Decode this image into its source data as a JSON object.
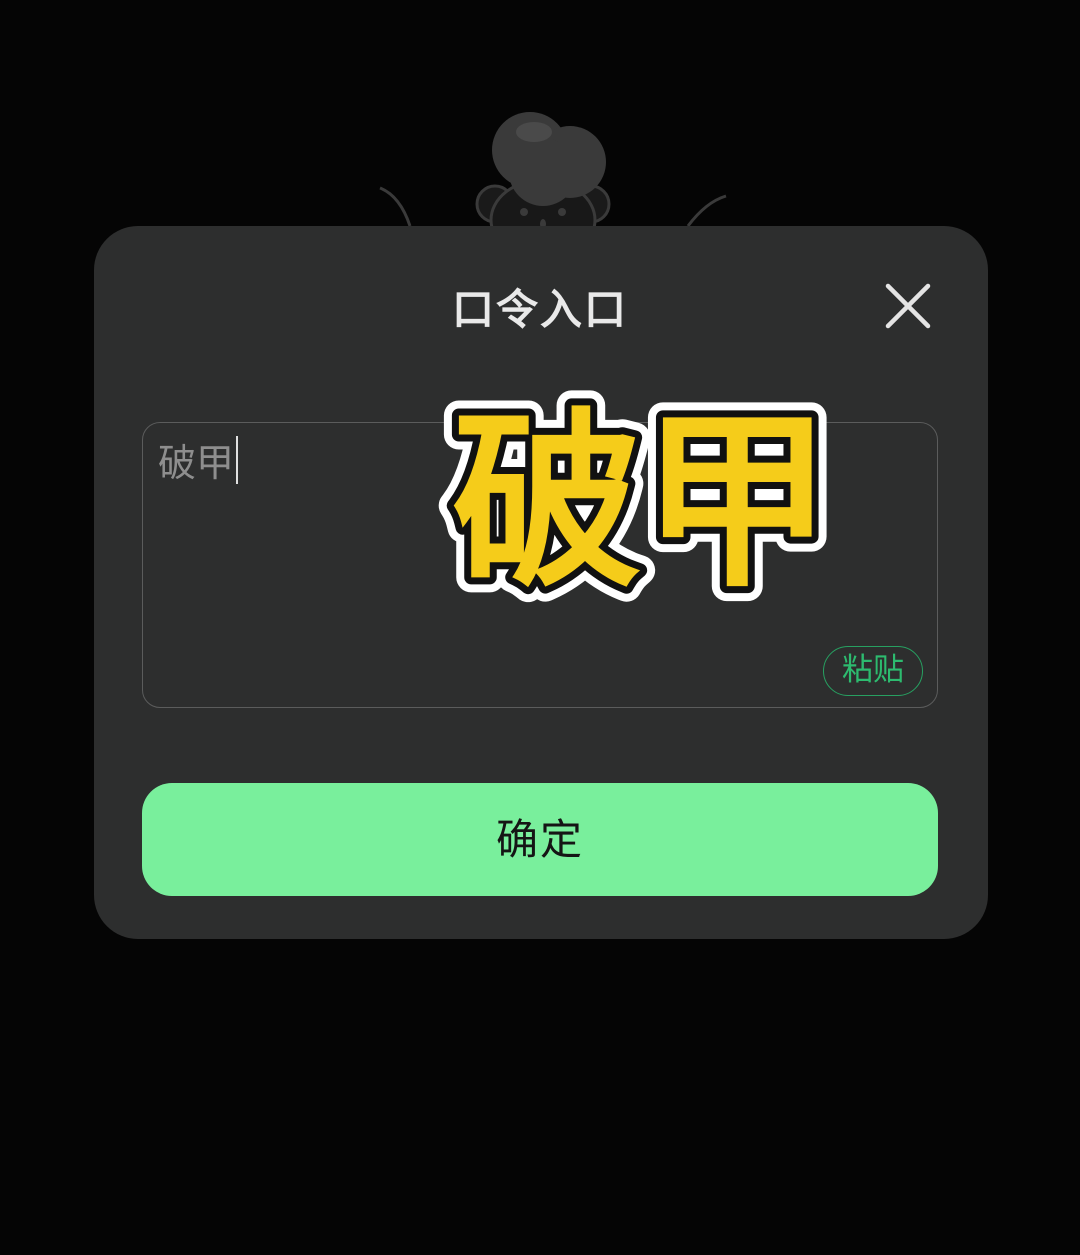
{
  "dialog": {
    "title": "口令入口",
    "input_value": "破甲",
    "paste_label": "粘贴",
    "confirm_label": "确定"
  },
  "overlay": {
    "sticker_text": "破甲"
  },
  "icons": {
    "close": "close-icon",
    "mascot": "mascot-illustration"
  },
  "colors": {
    "page_bg": "#050505",
    "dialog_bg": "#2d2e2e",
    "confirm_bg": "#79ef9c",
    "paste_accent": "#2dbb6f",
    "sticker_fill": "#f5cc1a"
  }
}
